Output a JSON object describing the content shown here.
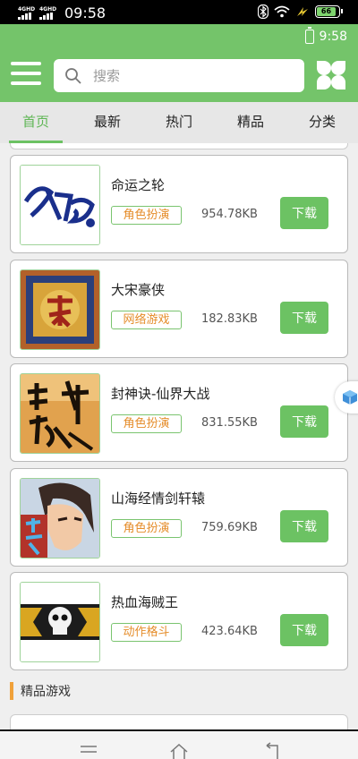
{
  "status_bar": {
    "network1": "4GHD",
    "network2": "4GHD",
    "time": "09:58",
    "battery": "66"
  },
  "header": {
    "app_time": "9:58",
    "search_placeholder": "搜索"
  },
  "tabs": [
    {
      "label": "首页",
      "active": true
    },
    {
      "label": "最新",
      "active": false
    },
    {
      "label": "热门",
      "active": false
    },
    {
      "label": "精品",
      "active": false
    },
    {
      "label": "分类",
      "active": false
    }
  ],
  "games": [
    {
      "title": "命运之轮",
      "tag": "角色扮演",
      "size": "954.78KB",
      "download_label": "下载",
      "icon": "calligraphy-logo-icon"
    },
    {
      "title": "大宋豪侠",
      "tag": "网络游戏",
      "size": "182.83KB",
      "download_label": "下载",
      "icon": "song-emblem-icon"
    },
    {
      "title": "封神诀-仙界大战",
      "tag": "角色扮演",
      "size": "831.55KB",
      "download_label": "下载",
      "icon": "fengshen-calligraphy-icon"
    },
    {
      "title": "山海经情剑轩辕",
      "tag": "角色扮演",
      "size": "759.69KB",
      "download_label": "下载",
      "icon": "anime-hero-icon"
    },
    {
      "title": "热血海贼王",
      "tag": "动作格斗",
      "size": "423.64KB",
      "download_label": "下载",
      "icon": "pirate-skull-icon"
    }
  ],
  "section": {
    "title": "精品游戏"
  },
  "colors": {
    "brand_green": "#74c46a",
    "tag_text": "#e58d2b",
    "section_accent": "#f0a13a"
  }
}
